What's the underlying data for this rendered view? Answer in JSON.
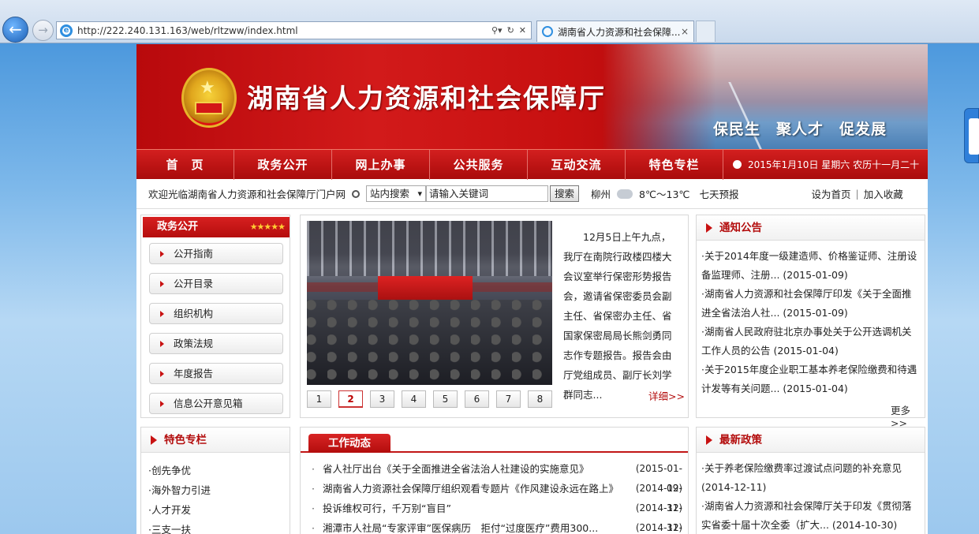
{
  "browser": {
    "url": "http://222.240.131.163/web/rltzww/index.html",
    "tab_title": "湖南省人力资源和社会保障...",
    "tab_close": "×"
  },
  "header": {
    "site_title": "湖南省人力资源和社会保障厅",
    "slogan": "保民生　聚人才　促发展"
  },
  "menu": {
    "items": [
      {
        "label": "首　页"
      },
      {
        "label": "政务公开"
      },
      {
        "label": "网上办事"
      },
      {
        "label": "公共服务"
      },
      {
        "label": "互动交流"
      },
      {
        "label": "特色专栏"
      }
    ],
    "date": "2015年1月10日  星期六  农历十一月二十"
  },
  "toolbar": {
    "welcome": "欢迎光临湖南省人力资源和社会保障厅门户网",
    "search_scope": "站内搜索",
    "search_placeholder": "请输入关键词",
    "search_button": "搜索",
    "city": "柳州",
    "temperature": "8℃～13℃",
    "forecast": "七天预报",
    "set_home": "设为首页",
    "divider": "|",
    "favorite": "加入收藏"
  },
  "gov_open": {
    "title": "政务公开",
    "stars": "★★★★★",
    "items": [
      {
        "label": "公开指南"
      },
      {
        "label": "公开目录"
      },
      {
        "label": "组织机构"
      },
      {
        "label": "政策法规"
      },
      {
        "label": "年度报告"
      },
      {
        "label": "信息公开意见箱"
      }
    ]
  },
  "headline": {
    "summary": "12月5日上午九点，我厅在南院行政楼四楼大会议室举行保密形势报告会，邀请省保密委员会副主任、省保密办主任、省国家保密局局长熊剑勇同志作专题报告。报告会由厅党组成员、副厅长刘学群同志...",
    "more": "详细>>",
    "pages": [
      "1",
      "2",
      "3",
      "4",
      "5",
      "6",
      "7",
      "8"
    ],
    "active_page": "2"
  },
  "notice": {
    "title": "通知公告",
    "items": [
      {
        "text": "·关于2014年度一级建造师、价格鉴证师、注册设备监理师、注册... (2015-01-09)"
      },
      {
        "text": "·湖南省人力资源和社会保障厅印发《关于全面推进全省法治人社... (2015-01-09)"
      },
      {
        "text": "·湖南省人民政府驻北京办事处关于公开选调机关工作人员的公告 (2015-01-04)"
      },
      {
        "text": "·关于2015年度企业职工基本养老保险缴费和待遇计发等有关问题... (2015-01-04)"
      }
    ],
    "more": "更多>>"
  },
  "special": {
    "title": "特色专栏",
    "items": [
      {
        "label": "·创先争优"
      },
      {
        "label": "·海外智力引进"
      },
      {
        "label": "·人才开发"
      },
      {
        "label": "·三支一扶"
      }
    ]
  },
  "work": {
    "title": "工作动态",
    "bullet": "·",
    "rows": [
      {
        "title": "省人社厅出台《关于全面推进全省法治人社建设的实施意见》",
        "date": "(2015-01-09)"
      },
      {
        "title": "湖南省人力资源社会保障厅组织观看专题片《作风建设永远在路上》",
        "date": "(2014-12-31)"
      },
      {
        "title": "投诉维权可行，千万别“盲目”",
        "date": "(2014-12-31)"
      },
      {
        "title": "湘潭市人社局“专家评审”医保病历　拒付“过度医疗”费用300...",
        "date": "(2014-12-31)"
      }
    ]
  },
  "policy": {
    "title": "最新政策",
    "items": [
      {
        "text": "·关于养老保险缴费率过渡试点问题的补充意见 (2014-12-11)"
      },
      {
        "text": "·湖南省人力资源和社会保障厅关于印发《贯彻落实省委十届十次全委（扩大... (2014-10-30)"
      }
    ]
  },
  "colors": {
    "brand_red": "#c81212",
    "title_red": "#b30c0c"
  }
}
